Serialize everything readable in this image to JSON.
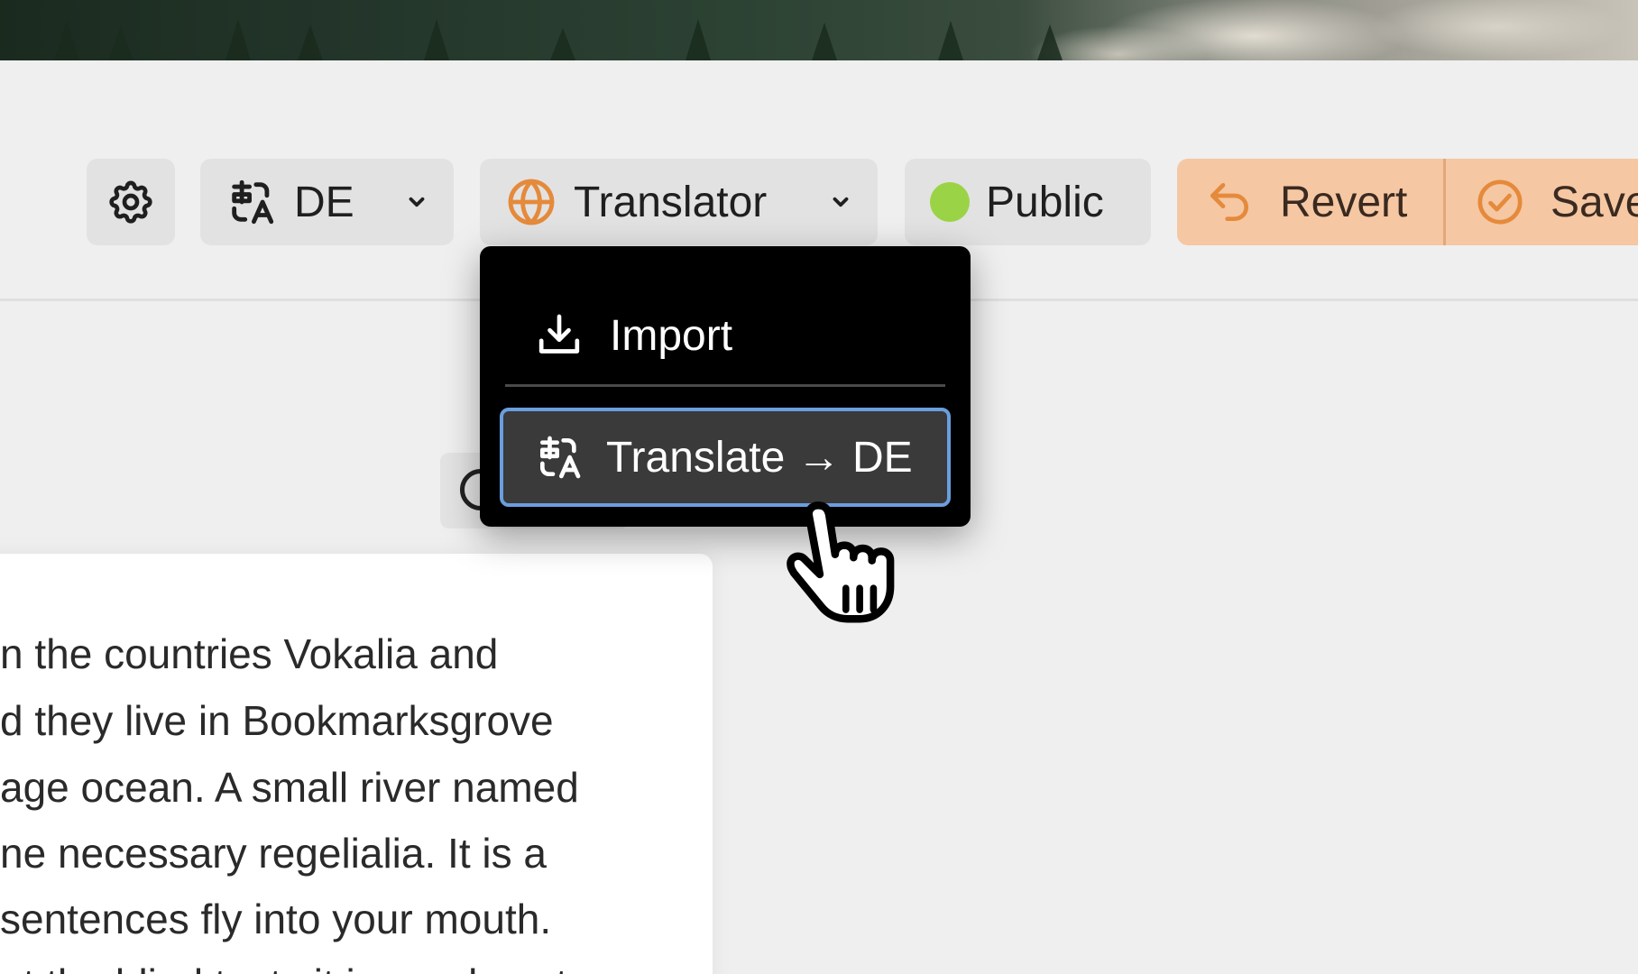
{
  "toolbar": {
    "language": {
      "label": "DE"
    },
    "translator": {
      "label": "Translator"
    },
    "visibility": {
      "label": "Public",
      "status_color": "#9bd346"
    },
    "revert": {
      "label": "Revert"
    },
    "save": {
      "label": "Save"
    }
  },
  "dropdown": {
    "items": [
      {
        "label": "Import",
        "icon": "download-icon"
      },
      {
        "label": "Translate → DE",
        "icon": "translate-icon",
        "highlighted": true
      }
    ]
  },
  "document": {
    "lines": [
      "n the countries Vokalia and",
      "d they live in Bookmarksgrove",
      "age ocean. A small river named",
      "ne necessary regelialia. It is a",
      " sentences fly into your mouth.",
      "ut the blind texts it is an almost"
    ]
  },
  "colors": {
    "accent_orange": "#f5c7a3",
    "icon_orange": "#e58a3b",
    "highlight_border": "#6a9ede"
  }
}
